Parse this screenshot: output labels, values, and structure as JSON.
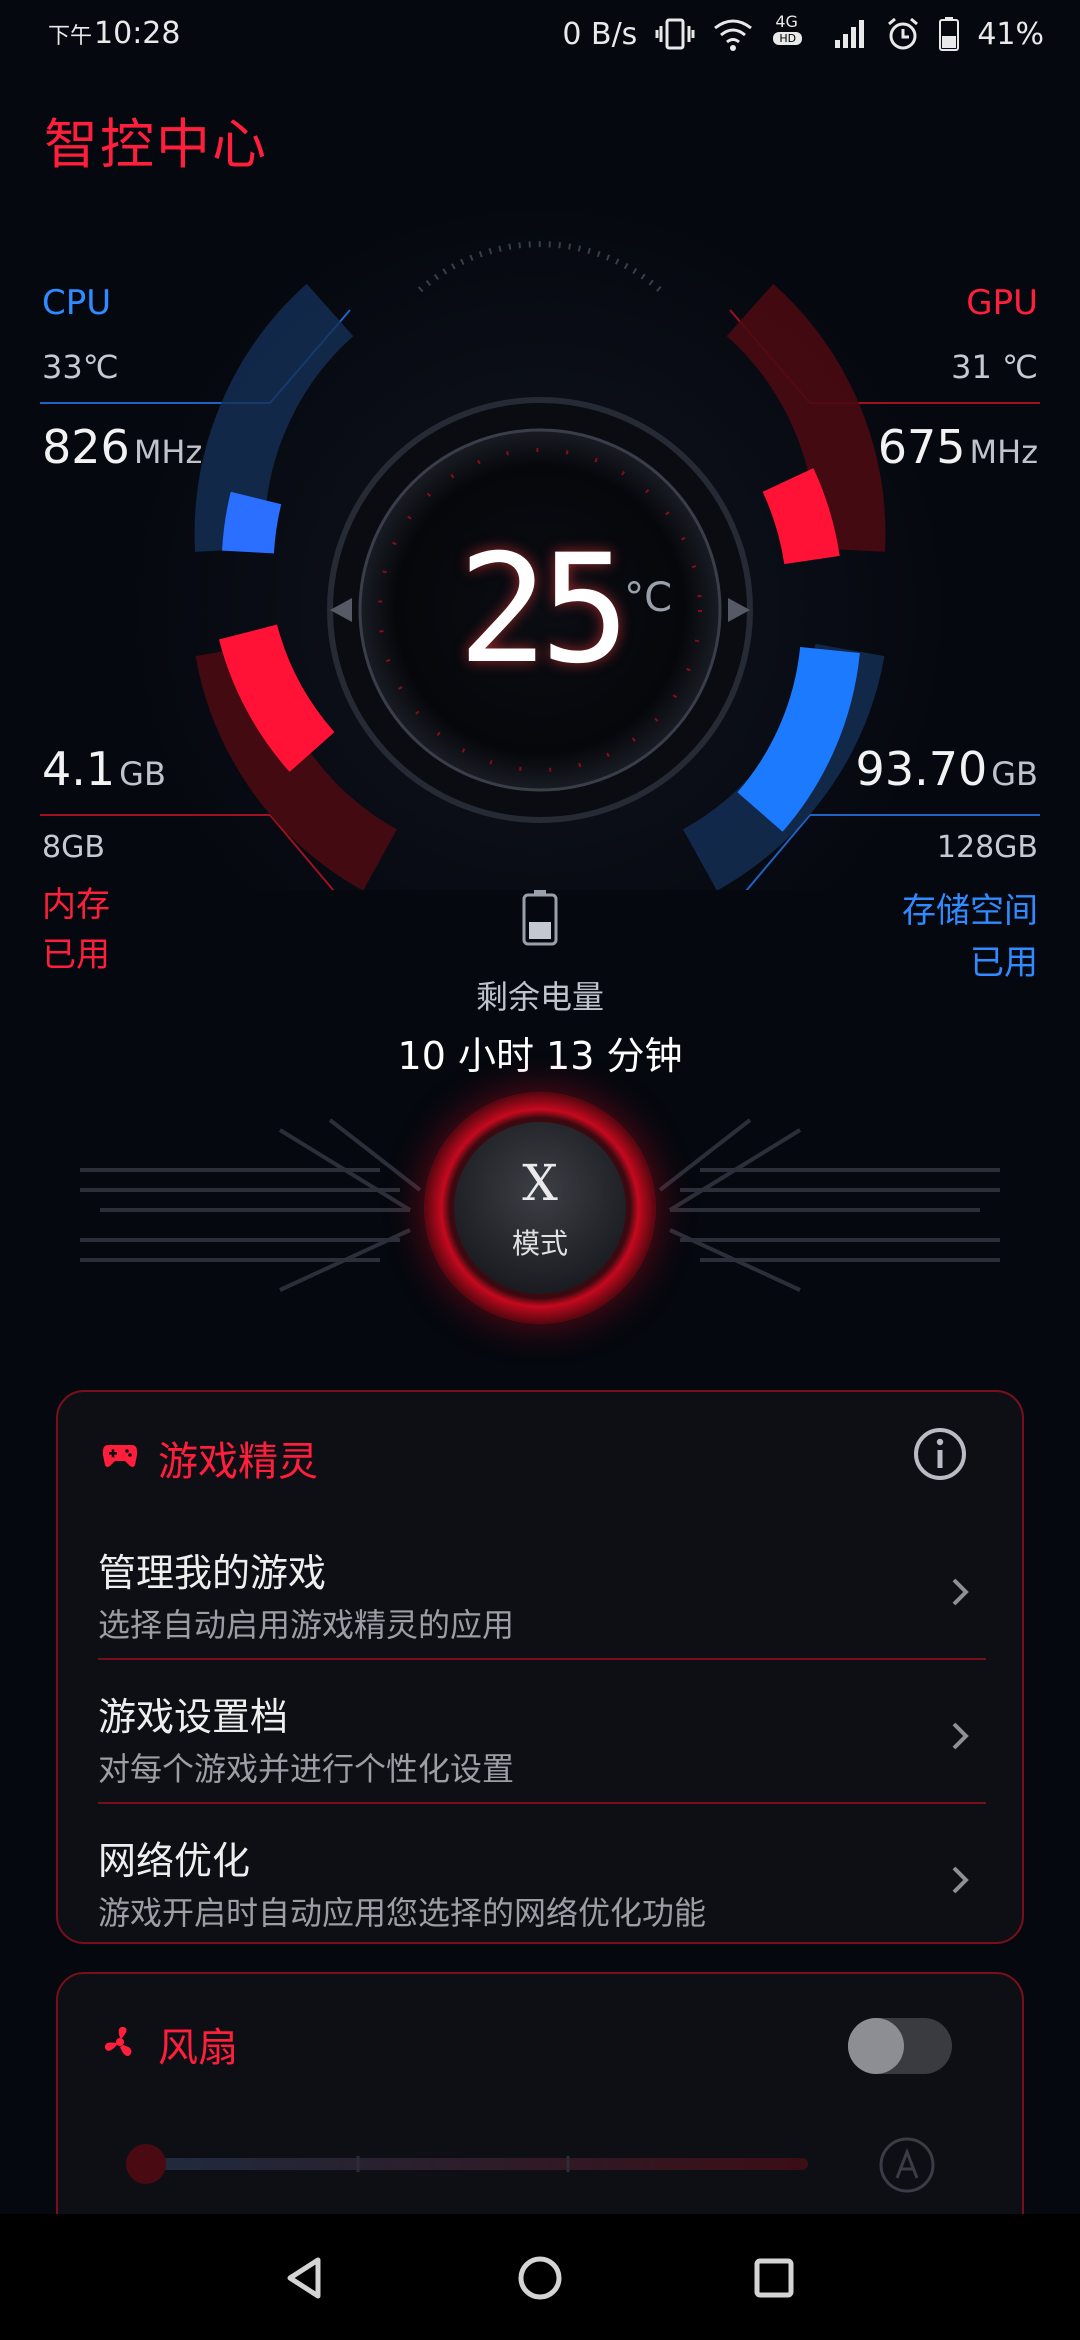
{
  "status_bar": {
    "time_prefix": "下午",
    "time": "10:28",
    "net_speed": "0 B/s",
    "network_badge": "4G",
    "network_sub": "HD",
    "battery": "41%"
  },
  "page": {
    "title": "智控中心"
  },
  "cpu": {
    "label": "CPU",
    "temp": "33℃",
    "freq_value": "826",
    "freq_unit": "MHz"
  },
  "gpu": {
    "label": "GPU",
    "temp": "31 ℃",
    "freq_value": "675",
    "freq_unit": "MHz"
  },
  "memory": {
    "used_value": "4.1",
    "used_unit": "GB",
    "total": "8GB",
    "label_line1": "内存",
    "label_line2": "已用"
  },
  "storage": {
    "used_value": "93.70",
    "used_unit": "GB",
    "total": "128GB",
    "label_line1": "存储空间",
    "label_line2": "已用"
  },
  "center": {
    "temperature": "25",
    "unit": "°C"
  },
  "battery_remaining": {
    "label": "剩余电量",
    "value": "10 小时 13 分钟"
  },
  "mode_button": {
    "glyph": "X",
    "label": "模式"
  },
  "game_genie": {
    "title": "游戏精灵",
    "rows": [
      {
        "title": "管理我的游戏",
        "subtitle": "选择自动启用游戏精灵的应用"
      },
      {
        "title": "游戏设置档",
        "subtitle": "对每个游戏并进行个性化设置"
      },
      {
        "title": "网络优化",
        "subtitle": "游戏开启时自动应用您选择的网络优化功能"
      }
    ]
  },
  "fan": {
    "title": "风扇",
    "enabled": false
  },
  "colors": {
    "accent_red": "#ff1e3c",
    "accent_blue": "#2f8bff",
    "card_border": "#7a0f1c"
  }
}
